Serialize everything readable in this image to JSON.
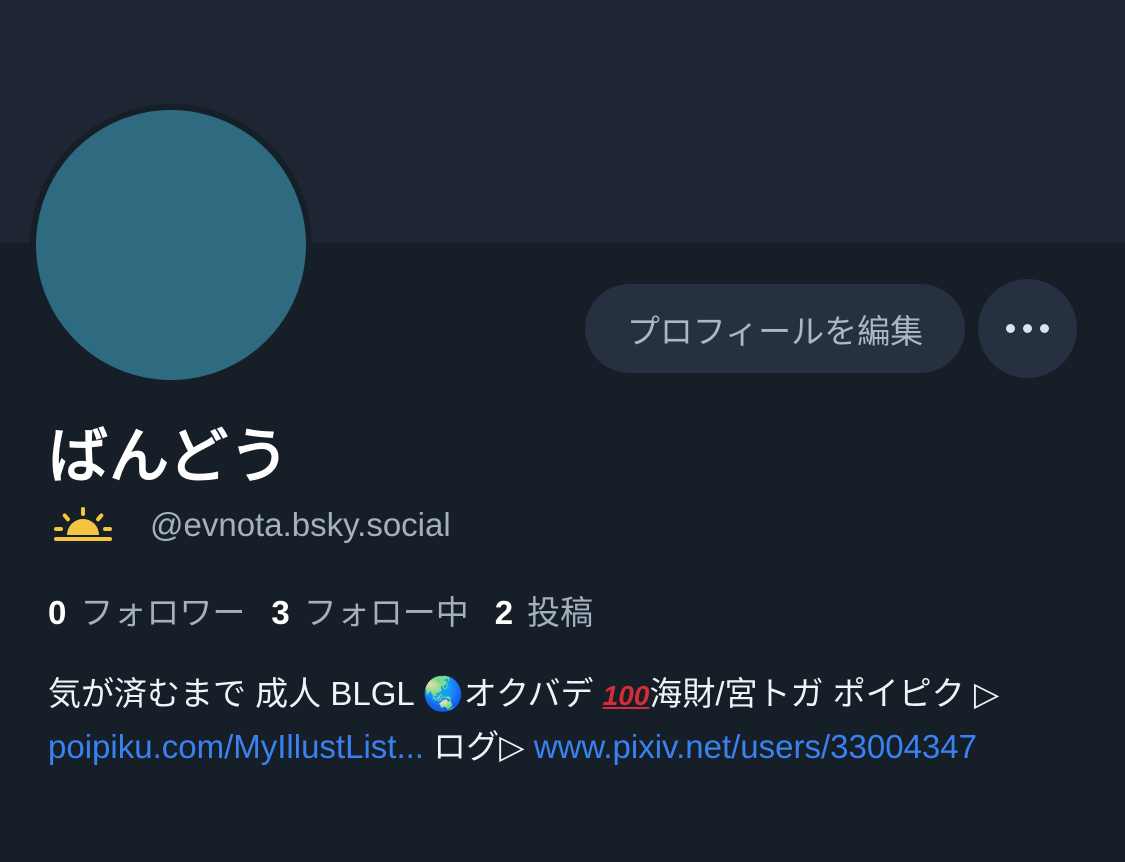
{
  "profile": {
    "display_name": "ばんどう",
    "handle": "@evnota.bsky.social",
    "status_icon": "sunrise-icon",
    "avatar_color": "#2e6b80",
    "banner_color": "#1f2633"
  },
  "actions": {
    "edit_label": "プロフィールを編集",
    "more_icon": "more-horizontal-icon"
  },
  "stats": {
    "followers_count": "0",
    "followers_label": "フォロワー",
    "following_count": "3",
    "following_label": "フォロー中",
    "posts_count": "2",
    "posts_label": "投稿"
  },
  "bio": {
    "text1": "気が済むまで 成人 BLGL ",
    "emoji_globe": "🌏",
    "text2": "オクバデ ",
    "emoji_hundred": "100",
    "text3": "海財/宮トガ ポイピク ▷ ",
    "link1": "poipiku.com/MyIllustList...",
    "text4": "  ログ▷ ",
    "link2": "www.pixiv.net/users/33004347"
  },
  "colors": {
    "link": "#3a82f1",
    "background": "#161e27",
    "button": "#263040"
  }
}
